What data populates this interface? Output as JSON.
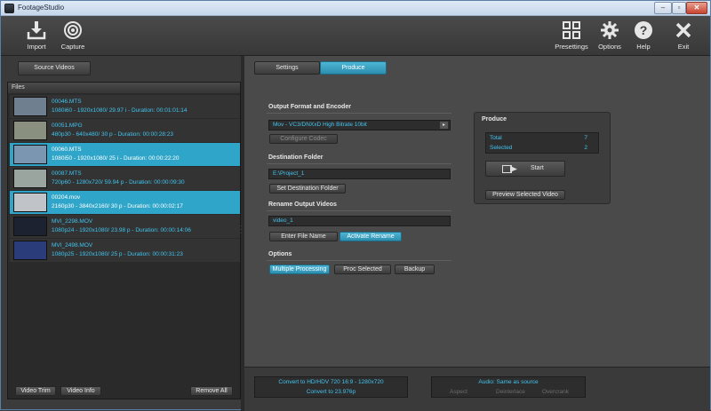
{
  "window": {
    "title": "FootageStudio",
    "minimize": "–",
    "maximize": "▫",
    "close": "✕"
  },
  "toolbar": {
    "import": "Import",
    "capture": "Capture",
    "presettings": "Presettings",
    "options": "Options",
    "help": "Help",
    "exit": "Exit"
  },
  "left": {
    "source_videos": "Source Videos",
    "files_title": "Files",
    "files": [
      {
        "name": "00046.MTS",
        "info": "1080i60 - 1920x1080/ 29.97 i  - Duration:  00:01:01:14",
        "selected": false,
        "thumb": "#6f7f8f"
      },
      {
        "name": "00051.MPG",
        "info": "480p30 - 640x480/ 30 p  - Duration:  00:00:28:23",
        "selected": false,
        "thumb": "#8a9080"
      },
      {
        "name": "00060.MTS",
        "info": "1080i50 - 1920x1080/ 25 i  - Duration:  00:00:22:20",
        "selected": true,
        "thumb": "#7a96b0"
      },
      {
        "name": "00087.MTS",
        "info": "720p60 - 1280x720/ 59.94 p  - Duration:  00:00:09:30",
        "selected": false,
        "thumb": "#9aa5a0"
      },
      {
        "name": "00204.mov",
        "info": "2160p30 - 3840x2160/ 30 p  - Duration:  00:00:02:17",
        "selected": true,
        "thumb": "#c0c4c8"
      },
      {
        "name": "MVI_2298.MOV",
        "info": "1080p24 - 1920x1080/ 23.98 p  - Duration:  00:00:14:06",
        "selected": false,
        "thumb": "#1c2230"
      },
      {
        "name": "MVI_2498.MOV",
        "info": "1080p25 - 1920x1080/ 25 p  - Duration:  00:00:31:23",
        "selected": false,
        "thumb": "#2a3d7a"
      }
    ],
    "video_trim": "Video Trim",
    "video_info": "Video Info",
    "remove_all": "Remove All"
  },
  "tabs": {
    "settings": "Settings",
    "produce": "Produce"
  },
  "output": {
    "heading": "Output Format and Encoder",
    "encoder": "Mov - VC3/DNXxD High Bitrate 10bit",
    "configure_codec": "Configure Codec"
  },
  "destination": {
    "heading": "Destination Folder",
    "path": "E:\\Project_1",
    "set_folder": "Set Destination Folder"
  },
  "rename": {
    "heading": "Rename Output Videos",
    "value": "video_1",
    "enter_file_name": "Enter File Name",
    "activate_rename": "Activate Rename"
  },
  "options": {
    "heading": "Options",
    "multiple_processing": "Multiple Processing",
    "proc_selected": "Proc Selected",
    "backup": "Backup"
  },
  "produce_box": {
    "title": "Produce",
    "total_label": "Total",
    "total_value": "7",
    "selected_label": "Selected",
    "selected_value": "2",
    "start": "Start",
    "preview": "Preview Selected Video"
  },
  "status": {
    "convert_line1": "Convert to HD/HDV 720 16:9 - 1280x720",
    "convert_line2": "Convert to 23.976p",
    "audio": "Audio:  Same as source",
    "aspect": "Aspect",
    "deinterlace": "Deinterlace",
    "overcrank": "Overcrank"
  },
  "colors": {
    "accent": "#2fa6c9",
    "text_blue": "#43c4f0"
  }
}
